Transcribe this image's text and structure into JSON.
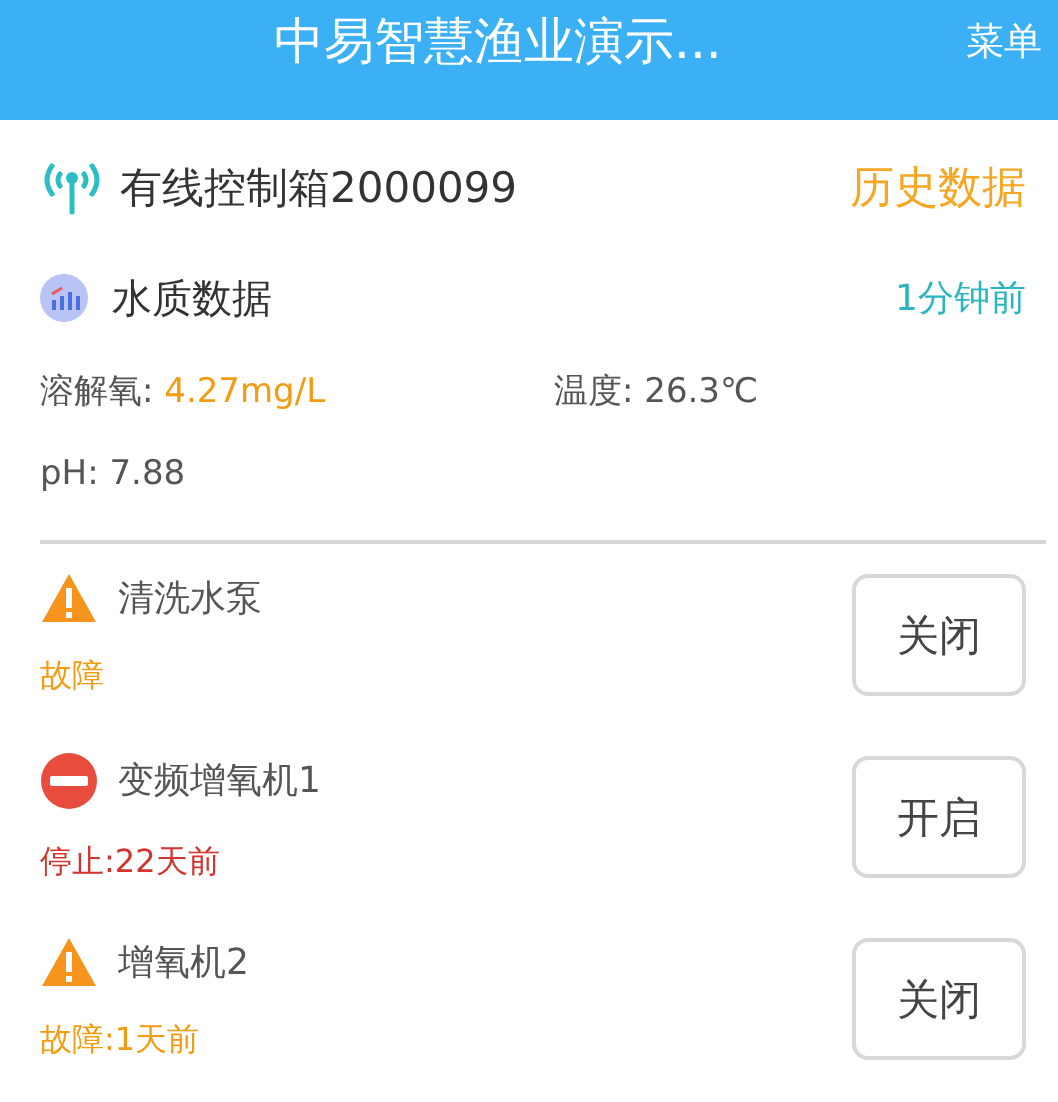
{
  "header": {
    "title": "中易智慧渔业演示...",
    "menu": "菜单"
  },
  "box": {
    "name": "有线控制箱2000099",
    "history": "历史数据"
  },
  "water": {
    "title": "水质数据",
    "time": "1分钟前",
    "readings": [
      {
        "label": "溶解氧: ",
        "value": "4.27mg/L",
        "alert": true
      },
      {
        "label": "温度: ",
        "value": "26.3℃",
        "alert": false
      },
      {
        "label": "pH: ",
        "value": "7.88",
        "alert": false
      }
    ]
  },
  "devices": [
    {
      "name": "清洗水泵",
      "kind": "fault",
      "status": "故障",
      "button": "关闭"
    },
    {
      "name": "变频增氧机1",
      "kind": "stopped",
      "status": "停止:22天前",
      "button": "开启"
    },
    {
      "name": "增氧机2",
      "kind": "fault",
      "status": "故障:1天前",
      "button": "关闭"
    }
  ]
}
